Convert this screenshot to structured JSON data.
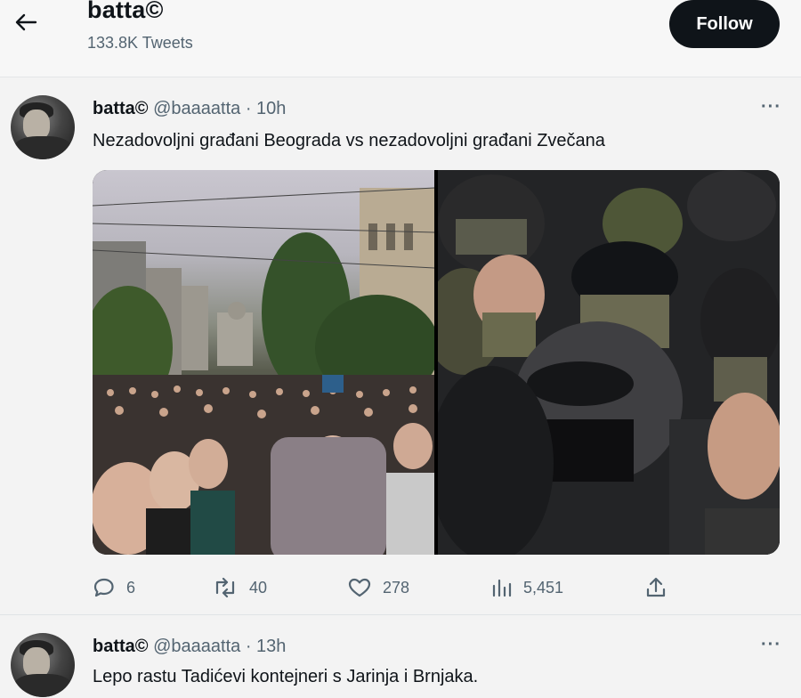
{
  "header": {
    "title": "batta©",
    "tweet_count": "133.8K Tweets",
    "follow_label": "Follow"
  },
  "tweets": [
    {
      "name": "batta©",
      "handle": "@baaaatta",
      "time": "· 10h",
      "text": "Nezadovoljni građani Beograda vs nezadovoljni građani Zvečana",
      "more": "···",
      "stats": {
        "replies": "6",
        "retweets": "40",
        "likes": "278",
        "views": "5,451"
      }
    },
    {
      "name": "batta©",
      "handle": "@baaaatta",
      "time": "· 13h",
      "text": "Lepo rastu Tadićevi kontejneri s Jarinja i Brnjaka.",
      "more": "···"
    }
  ],
  "icons": [
    "back-arrow-icon",
    "reply-icon",
    "retweet-icon",
    "like-icon",
    "views-icon",
    "share-icon"
  ],
  "colors": {
    "text": "#0f1419",
    "muted": "#536471",
    "follow_bg": "#0f1419",
    "background": "#f3f3f3"
  }
}
